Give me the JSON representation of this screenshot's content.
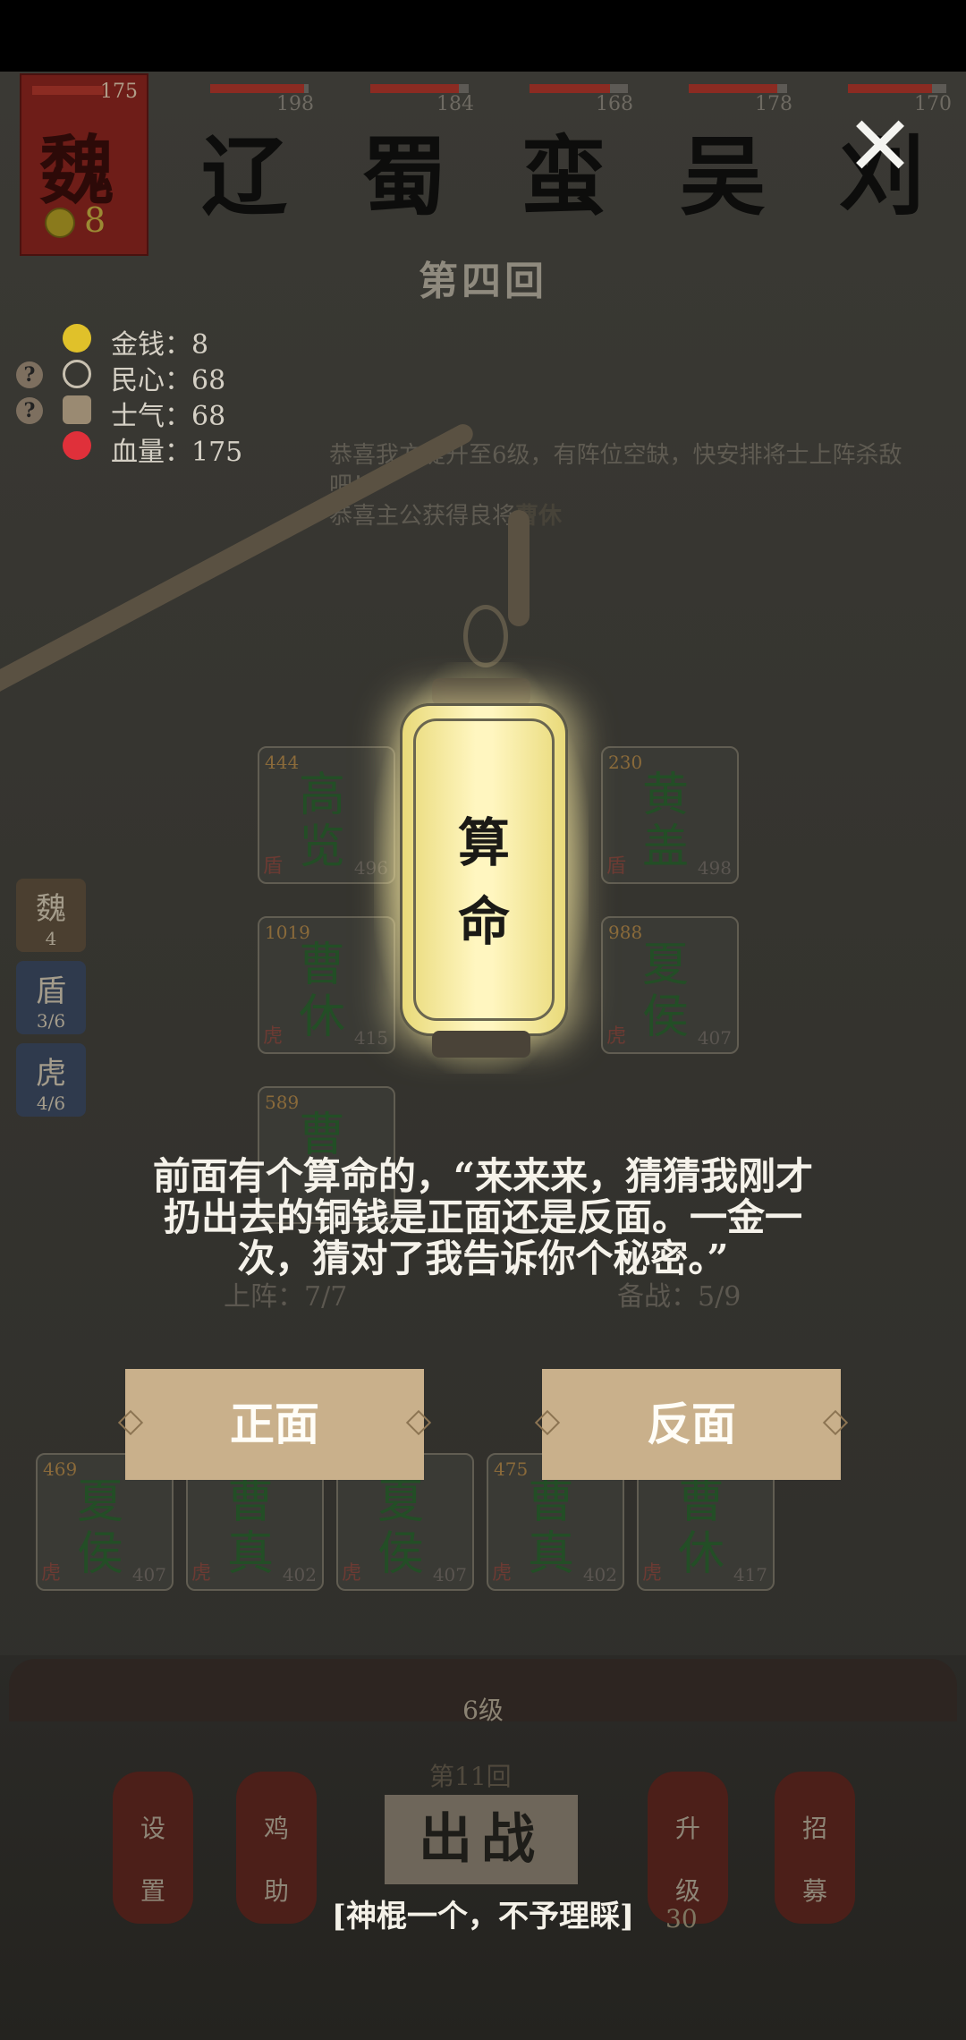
{
  "player": {
    "faction": "魏",
    "hp": "175",
    "coins": "8"
  },
  "enemies": [
    {
      "name": "辽",
      "hp": "198",
      "hp_fraction": 0.95
    },
    {
      "name": "蜀",
      "hp": "184",
      "hp_fraction": 0.9
    },
    {
      "name": "蛮",
      "hp": "168",
      "hp_fraction": 0.82
    },
    {
      "name": "吴",
      "hp": "178",
      "hp_fraction": 0.9
    },
    {
      "name": "刈",
      "hp": "170",
      "hp_fraction": 0.85
    }
  ],
  "round_title": "第四回",
  "stats": [
    {
      "label": "金钱：8",
      "icon": "coin-icon",
      "has_help": false
    },
    {
      "label": "民心：68",
      "icon": "heart-outline-icon",
      "has_help": true
    },
    {
      "label": "士气：68",
      "icon": "morale-icon",
      "has_help": true
    },
    {
      "label": "血量：175",
      "icon": "heart-icon",
      "has_help": false
    }
  ],
  "log": {
    "line1": "恭喜我方提升至6级，有阵位空缺，快安排将士上阵杀敌吧！",
    "line2_prefix": "恭喜主公获得良将",
    "line2_name": "曹休"
  },
  "tabs": [
    {
      "t1": "魏",
      "t2": "4"
    },
    {
      "t1": "盾",
      "t2": "3/6"
    },
    {
      "t1": "虎",
      "t2": "4/6"
    }
  ],
  "field_units": [
    {
      "power": "444",
      "n1": "高",
      "n2": "览",
      "type": "盾",
      "hp": "496"
    },
    {
      "power": "230",
      "n1": "黄",
      "n2": "盖",
      "type": "盾",
      "hp": "498"
    },
    {
      "power": "1019",
      "n1": "曹",
      "n2": "休",
      "type": "虎",
      "hp": "415"
    },
    {
      "power": "988",
      "n1": "夏",
      "n2": "侯",
      "type": "虎",
      "hp": "407"
    },
    {
      "power": "589",
      "n1": "曹",
      "n2": "",
      "type": "",
      "hp": ""
    }
  ],
  "counters": {
    "on_field": "上阵：7/7",
    "reserve": "备战：5/9"
  },
  "lantern": {
    "line1": "算",
    "line2": "命"
  },
  "dialog": "前面有个算命的，“来来来，猜猜我刚才扔出去的铜钱是正面还是反面。一金一次，猜对了我告诉你个秘密。”",
  "choices": {
    "heads": "正面",
    "tails": "反面"
  },
  "roster": [
    {
      "power": "469",
      "n1": "夏",
      "n2": "侯",
      "type": "虎",
      "hp": "407"
    },
    {
      "power": "",
      "n1": "曹",
      "n2": "真",
      "type": "虎",
      "hp": "402"
    },
    {
      "power": "",
      "n1": "夏",
      "n2": "侯",
      "type": "虎",
      "hp": "407"
    },
    {
      "power": "475",
      "n1": "曹",
      "n2": "真",
      "type": "虎",
      "hp": "402"
    },
    {
      "power": "",
      "n1": "曹",
      "n2": "休",
      "type": "虎",
      "hp": "417"
    }
  ],
  "bottom": {
    "level": "6级",
    "settings": [
      "设",
      "置"
    ],
    "cheer": [
      "鸡",
      "助"
    ],
    "sortie": "出战",
    "sortie_round": "第11回",
    "upgrade": [
      "升",
      "级"
    ],
    "recruit": [
      "招",
      "募"
    ],
    "subtitle": "[神棍一个，不予理睬]",
    "cost": "30"
  }
}
